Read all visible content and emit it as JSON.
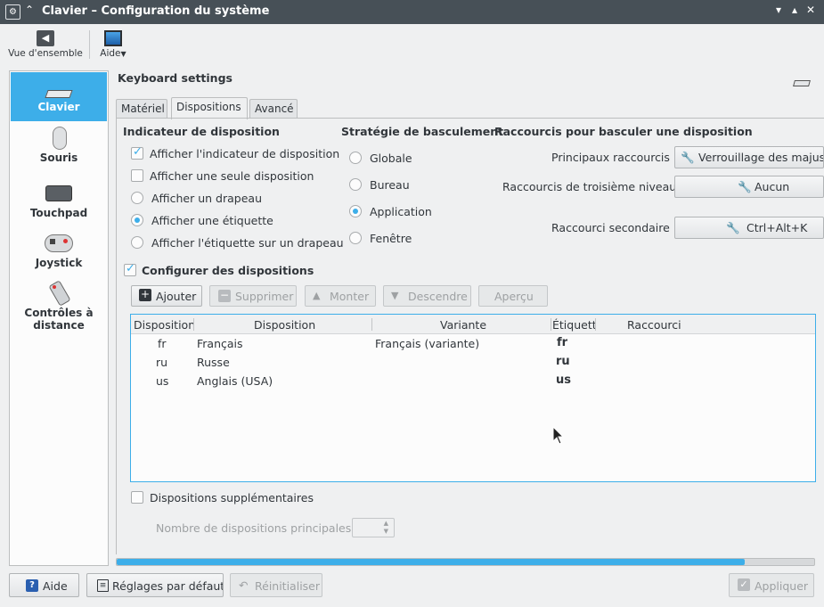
{
  "window": {
    "title": "Clavier – Configuration du système",
    "minimize": "▾",
    "maximize": "▴",
    "close": "✕"
  },
  "toolbar": {
    "overview_label": "Vue d'ensemble",
    "help_label": "Aide"
  },
  "sidebar": {
    "items": [
      {
        "label": "Clavier",
        "icon": "keyboard-icon",
        "selected": true
      },
      {
        "label": "Souris",
        "icon": "mouse-icon"
      },
      {
        "label": "Touchpad",
        "icon": "touchpad-icon"
      },
      {
        "label": "Joystick",
        "icon": "joystick-icon"
      },
      {
        "label": "Contrôles à distance",
        "icon": "remote-control-icon"
      }
    ]
  },
  "header": {
    "title": "Keyboard settings"
  },
  "tabs": [
    {
      "label": "Matériel"
    },
    {
      "label": "Dispositions",
      "active": true
    },
    {
      "label": "Avancé"
    }
  ],
  "indicator": {
    "heading": "Indicateur de disposition",
    "show_indicator": {
      "label": "Afficher l'indicateur de disposition",
      "checked": true
    },
    "show_single": {
      "label": "Afficher une seule disposition",
      "checked": false
    },
    "options": [
      {
        "label": "Afficher un drapeau",
        "selected": false
      },
      {
        "label": "Afficher une étiquette",
        "selected": true
      },
      {
        "label": "Afficher l'étiquette sur un drapeau",
        "selected": false
      }
    ]
  },
  "strategy": {
    "heading": "Stratégie de basculement",
    "options": [
      {
        "label": "Globale",
        "selected": false
      },
      {
        "label": "Bureau",
        "selected": false
      },
      {
        "label": "Application",
        "selected": true
      },
      {
        "label": "Fenêtre",
        "selected": false
      }
    ]
  },
  "shortcuts": {
    "heading": "Raccourcis pour basculer une disposition",
    "main_label": "Principaux raccourcis :",
    "main_value": "Verrouillage des majus",
    "third_label": "Raccourcis de troisième niveau :",
    "third_value": "Aucun",
    "secondary_label": "Raccourci secondaire :",
    "secondary_value": "Ctrl+Alt+K"
  },
  "layouts": {
    "configure_label": "Configurer des dispositions",
    "configure_checked": true,
    "buttons": {
      "add": "Ajouter",
      "remove": "Supprimer",
      "up": "Monter",
      "down": "Descendre",
      "preview": "Aperçu"
    },
    "columns": [
      "Disposition",
      "Disposition",
      "Variante",
      "Étiquette",
      "Raccourci"
    ],
    "rows": [
      {
        "code": "fr",
        "name": "Français",
        "variant": "Français (variante)",
        "label": "fr",
        "shortcut": ""
      },
      {
        "code": "ru",
        "name": "Russe",
        "variant": "",
        "label": "ru",
        "shortcut": ""
      },
      {
        "code": "us",
        "name": "Anglais (USA)",
        "variant": "",
        "label": "us",
        "shortcut": ""
      }
    ]
  },
  "extra": {
    "label": "Dispositions supplémentaires",
    "checked": false,
    "main_count_label": "Nombre de dispositions principales :",
    "main_count_value": ""
  },
  "progress": {
    "fraction": 0.9
  },
  "footer": {
    "help": "Aide",
    "defaults": "Réglages par défaut",
    "reset": "Réinitialiser",
    "apply": "Appliquer"
  },
  "colors": {
    "accent": "#3daee9",
    "titlebar": "#475057",
    "background": "#eff0f1"
  }
}
